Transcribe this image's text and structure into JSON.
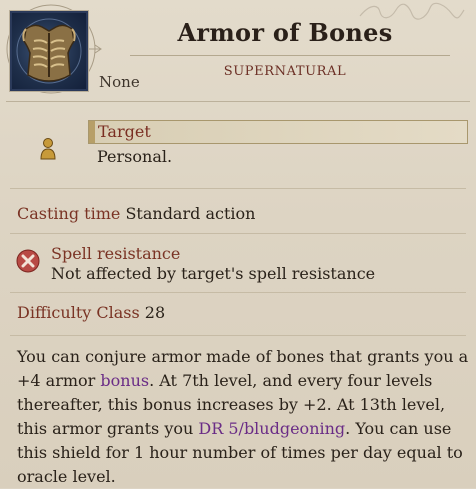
{
  "spell": {
    "title": "Armor of Bones",
    "school": "SUPERNATURAL",
    "subtext": "None"
  },
  "icons": {
    "spell_icon": "bone-armor-icon",
    "target_icon": "person-icon",
    "resistance_icon": "crossed-circle-icon"
  },
  "target": {
    "label": "Target",
    "value": "Personal."
  },
  "casting": {
    "label": "Casting time",
    "value": "Standard action"
  },
  "resistance": {
    "label": "Spell resistance",
    "value": "Not affected by target's spell resistance"
  },
  "difficulty": {
    "label": "Difficulty Class",
    "value": "28"
  },
  "description": {
    "p1": "You can conjure armor made of bones that grants you a +4 armor ",
    "kw1": "bonus",
    "p2": ". At 7th level, and every four levels thereafter, this bonus increases by +2. At 13th level, this armor grants you ",
    "kw2": "DR 5/bludgeoning",
    "p3": ". You can use this shield for 1 hour number of times per day equal to oracle level."
  },
  "colors": {
    "background": "#ddd4c4",
    "label_red": "#7a3324",
    "keyword_purple": "#6a2c86",
    "portrait_blue": "#1e2e49"
  }
}
